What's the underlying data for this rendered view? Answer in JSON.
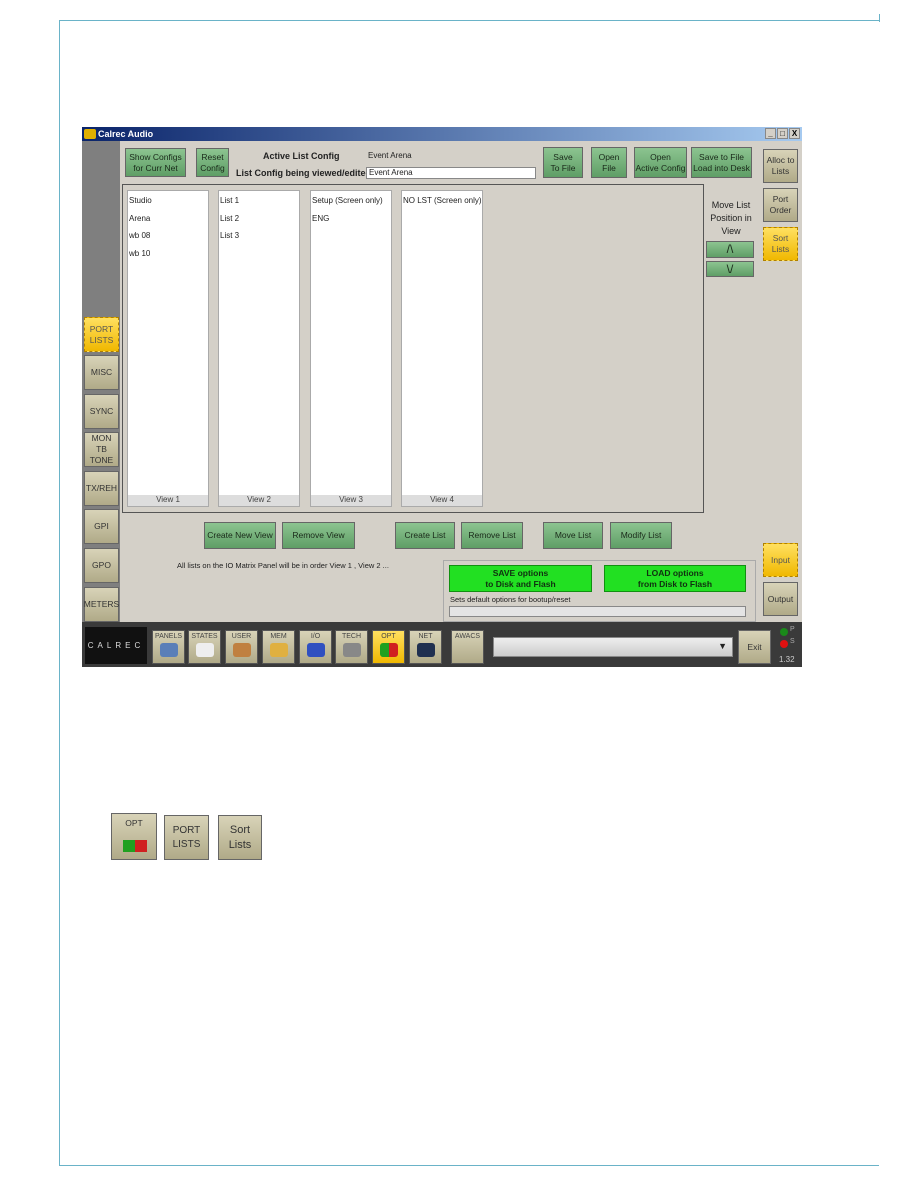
{
  "window": {
    "title": "Calrec Audio",
    "controls": [
      "_",
      "□",
      "X"
    ]
  },
  "sidebar": [
    {
      "label": "PORT\nLISTS",
      "active": true
    },
    {
      "label": "MISC"
    },
    {
      "label": "SYNC"
    },
    {
      "label": "MON\nTB\nTONE"
    },
    {
      "label": "TX/REH"
    },
    {
      "label": "GPI"
    },
    {
      "label": "GPO"
    },
    {
      "label": "METERS"
    }
  ],
  "top": {
    "show_configs": "Show Configs\nfor Curr Net",
    "reset_config": "Reset\nConfig",
    "active_label": "Active List Config",
    "active_value": "Event Arena",
    "edited_label": "List Config being viewed/edited",
    "edited_value": "Event Arena",
    "save_to_file": "Save\nTo File",
    "open_file": "Open\nFile",
    "open_active": "Open\nActive Config",
    "save_load": "Save to File\nLoad into Desk"
  },
  "right": {
    "alloc": "Alloc to\nLists",
    "port_order": "Port\nOrder",
    "sort_lists": "Sort\nLists",
    "input": "Input",
    "output": "Output"
  },
  "views": [
    {
      "items": [
        "Studio",
        "Arena",
        "wb 08",
        "wb 10"
      ],
      "footer": "View 1"
    },
    {
      "items": [
        "List 1",
        "List 2",
        "List 3"
      ],
      "footer": "View 2"
    },
    {
      "items": [
        "Setup (Screen only)",
        "ENG"
      ],
      "footer": "View 3"
    },
    {
      "items": [
        "NO LST (Screen only)"
      ],
      "footer": "View 4"
    }
  ],
  "move": {
    "label": "Move List\nPosition in\nView",
    "up": "/\\",
    "down": "\\/"
  },
  "actions": {
    "create_view": "Create New View",
    "remove_view": "Remove View",
    "create_list": "Create List",
    "remove_list": "Remove List",
    "move_list": "Move List",
    "modify_list": "Modify List"
  },
  "info": "All lists on the IO Matrix Panel will be in order View 1 , View 2 ...",
  "options": {
    "save": "SAVE options\nto Disk and Flash",
    "load": "LOAD options\nfrom Disk to Flash",
    "note": "Sets default options for bootup/reset",
    "progress": 0
  },
  "taskbar": {
    "logo": "CALREC",
    "buttons": [
      "PANELS",
      "STATES",
      "USER",
      "MEM",
      "I/O",
      "TECH",
      "OPT",
      "NET"
    ],
    "active": "OPT",
    "awacs": "AWACS",
    "exit": "Exit",
    "led_p": "P",
    "led_s": "S",
    "version": "1.32"
  },
  "legend_icons": {
    "opt": "OPT",
    "port_lists": "PORT\nLISTS",
    "sort_lists": "Sort\nLists"
  },
  "colors": {
    "active": "#f0b800",
    "button_green": "#5f9e66",
    "bright_green": "#22e022",
    "frame": "#6ab3c8"
  }
}
